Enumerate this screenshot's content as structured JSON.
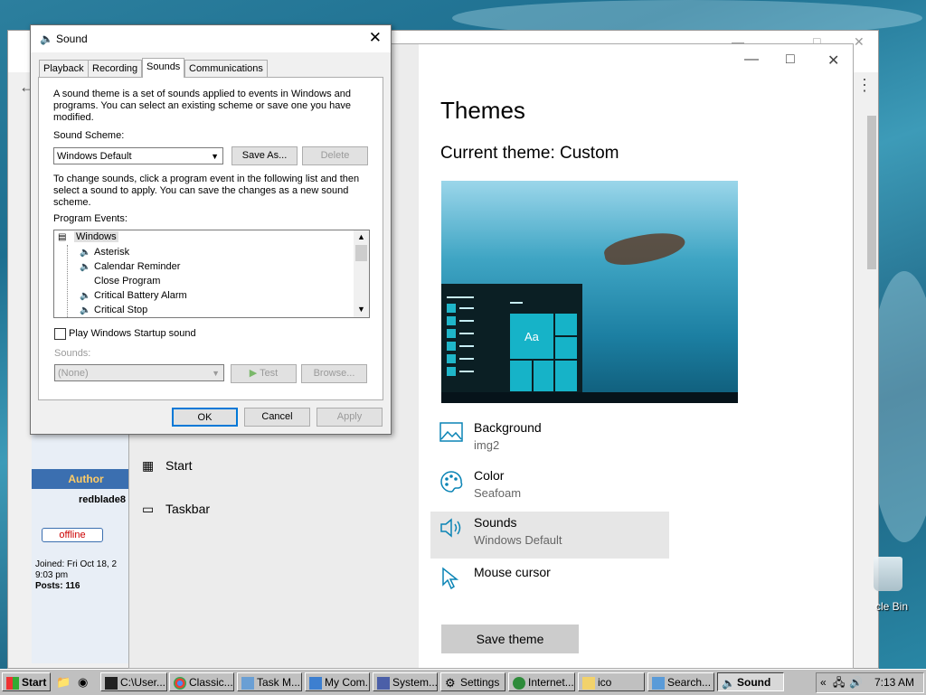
{
  "desktop": {
    "recycle_bin_label": "cle Bin"
  },
  "forum": {
    "author_header": "Author",
    "username": "redblade8",
    "status": "offline",
    "joined_line1": "Joined: Fri Oct 18, 2",
    "joined_line2": "9:03 pm",
    "posts": "Posts: 116"
  },
  "settings": {
    "nav": [
      {
        "label": "Start",
        "icon": "start-icon"
      },
      {
        "label": "Taskbar",
        "icon": "taskbar-icon"
      }
    ],
    "title": "Themes",
    "current_theme": "Current theme: Custom",
    "preview_tile_label": "Aa",
    "options": [
      {
        "title": "Background",
        "subtitle": "img2",
        "icon": "picture-icon"
      },
      {
        "title": "Color",
        "subtitle": "Seafoam",
        "icon": "palette-icon"
      },
      {
        "title": "Sounds",
        "subtitle": "Windows Default",
        "icon": "speaker-icon"
      },
      {
        "title": "Mouse cursor",
        "subtitle": "",
        "icon": "cursor-icon"
      }
    ],
    "save_theme": "Save theme"
  },
  "sound_dialog": {
    "title": "Sound",
    "tabs": [
      "Playback",
      "Recording",
      "Sounds",
      "Communications"
    ],
    "active_tab": "Sounds",
    "intro": "A sound theme is a set of sounds applied to events in Windows and programs.  You can select an existing scheme or save one you have modified.",
    "scheme_label": "Sound Scheme:",
    "scheme_value": "Windows Default",
    "save_as": "Save As...",
    "delete": "Delete",
    "change_text": "To change sounds, click a program event in the following list and then select a sound to apply.  You can save the changes as a new sound scheme.",
    "events_label": "Program Events:",
    "events_root": "Windows",
    "events": [
      "Asterisk",
      "Calendar Reminder",
      "Close Program",
      "Critical Battery Alarm",
      "Critical Stop"
    ],
    "startup_checkbox": "Play Windows Startup sound",
    "startup_checked": false,
    "sounds_label": "Sounds:",
    "sounds_value": "(None)",
    "test": "Test",
    "browse": "Browse...",
    "ok": "OK",
    "cancel": "Cancel",
    "apply": "Apply"
  },
  "taskbar": {
    "start": "Start",
    "items": [
      {
        "label": "C:\\User...",
        "icon": "cmd-icon"
      },
      {
        "label": "Classic...",
        "icon": "chrome-icon"
      },
      {
        "label": "Task M...",
        "icon": "task-manager-icon"
      },
      {
        "label": "My Com...",
        "icon": "my-computer-icon"
      },
      {
        "label": "System...",
        "icon": "system-icon"
      },
      {
        "label": "Settings",
        "icon": "gear-icon"
      },
      {
        "label": "Internet...",
        "icon": "internet-icon"
      },
      {
        "label": "ico",
        "icon": "folder-icon"
      },
      {
        "label": "Search...",
        "icon": "search-icon"
      },
      {
        "label": "Sound",
        "icon": "speaker-icon"
      }
    ],
    "tray_chevron": "«",
    "clock": "7:13 AM"
  }
}
